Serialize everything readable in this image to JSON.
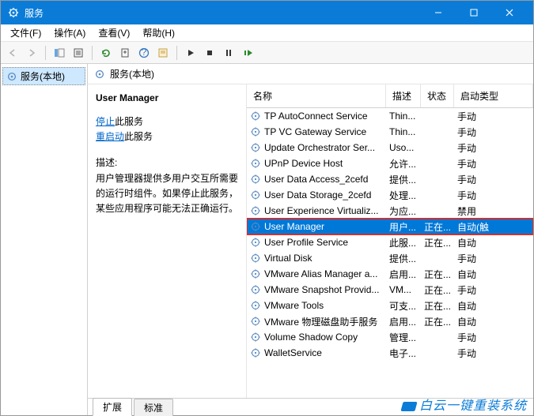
{
  "titlebar": {
    "title": "服务"
  },
  "menu": {
    "file": "文件(F)",
    "action": "操作(A)",
    "view": "查看(V)",
    "help": "帮助(H)"
  },
  "tree": {
    "root": "服务(本地)"
  },
  "header": {
    "label": "服务(本地)"
  },
  "detail": {
    "title": "User Manager",
    "stop_link": "停止",
    "stop_suffix": "此服务",
    "restart_link": "重启动",
    "restart_suffix": "此服务",
    "desc_label": "描述:",
    "desc_text": "用户管理器提供多用户交互所需要的运行时组件。如果停止此服务，某些应用程序可能无法正确运行。"
  },
  "columns": {
    "name": "名称",
    "desc": "描述",
    "status": "状态",
    "type": "启动类型"
  },
  "services": [
    {
      "name": "TP AutoConnect Service",
      "desc": "Thin...",
      "status": "",
      "type": "手动"
    },
    {
      "name": "TP VC Gateway Service",
      "desc": "Thin...",
      "status": "",
      "type": "手动"
    },
    {
      "name": "Update Orchestrator Ser...",
      "desc": "Uso...",
      "status": "",
      "type": "手动"
    },
    {
      "name": "UPnP Device Host",
      "desc": "允许...",
      "status": "",
      "type": "手动"
    },
    {
      "name": "User Data Access_2cefd",
      "desc": "提供...",
      "status": "",
      "type": "手动"
    },
    {
      "name": "User Data Storage_2cefd",
      "desc": "处理...",
      "status": "",
      "type": "手动"
    },
    {
      "name": "User Experience Virtualiz...",
      "desc": "为应...",
      "status": "",
      "type": "禁用"
    },
    {
      "name": "User Manager",
      "desc": "用户...",
      "status": "正在...",
      "type": "自动(触",
      "selected": true
    },
    {
      "name": "User Profile Service",
      "desc": "此服...",
      "status": "正在...",
      "type": "自动"
    },
    {
      "name": "Virtual Disk",
      "desc": "提供...",
      "status": "",
      "type": "手动"
    },
    {
      "name": "VMware Alias Manager a...",
      "desc": "启用...",
      "status": "正在...",
      "type": "自动"
    },
    {
      "name": "VMware Snapshot Provid...",
      "desc": "VM...",
      "status": "正在...",
      "type": "手动"
    },
    {
      "name": "VMware Tools",
      "desc": "可支...",
      "status": "正在...",
      "type": "自动"
    },
    {
      "name": "VMware 物理磁盘助手服务",
      "desc": "启用...",
      "status": "正在...",
      "type": "自动"
    },
    {
      "name": "Volume Shadow Copy",
      "desc": "管理...",
      "status": "",
      "type": "手动"
    },
    {
      "name": "WalletService",
      "desc": "电子...",
      "status": "",
      "type": "手动"
    }
  ],
  "tabs": {
    "extended": "扩展",
    "standard": "标准"
  },
  "watermark": "白云一键重装系统"
}
